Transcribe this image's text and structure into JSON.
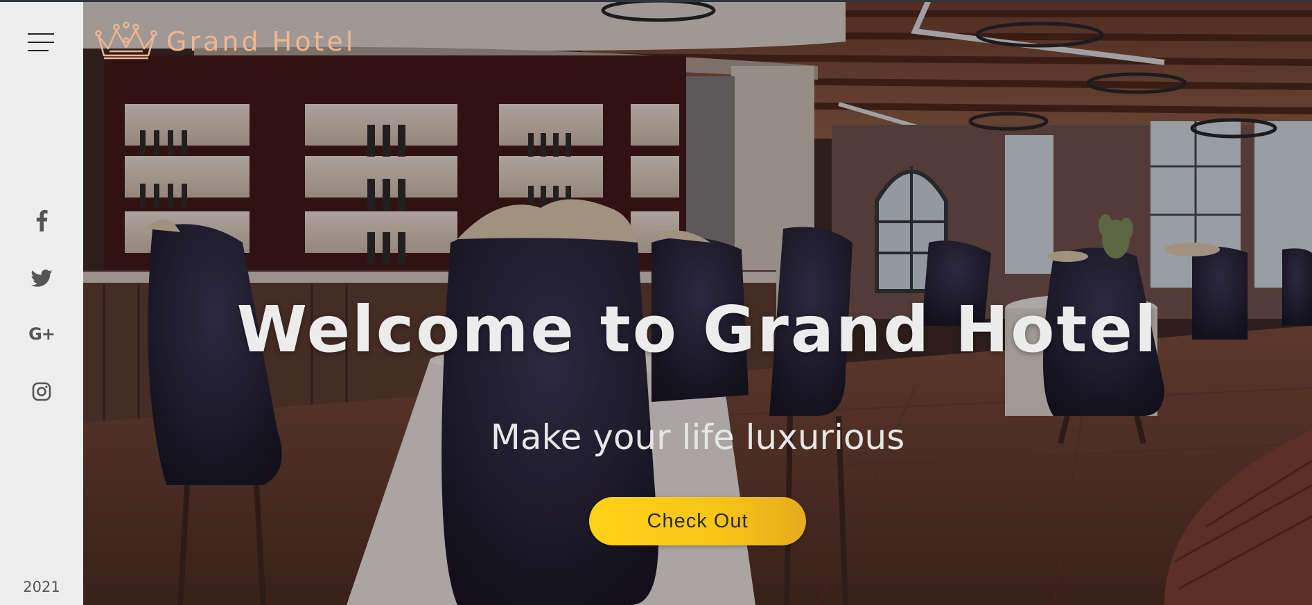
{
  "brand": {
    "name": "Grand Hotel",
    "logo_icon": "crown-icon",
    "color": "#f0b690"
  },
  "sidebar": {
    "menu_icon": "hamburger-menu-icon",
    "social": [
      {
        "name": "facebook-icon"
      },
      {
        "name": "twitter-icon"
      },
      {
        "name": "google-plus-icon",
        "label": "G+"
      },
      {
        "name": "instagram-icon"
      }
    ],
    "year": "2021"
  },
  "hero": {
    "title": "Welcome to Grand Hotel",
    "subtitle": "Make your life luxurious",
    "cta_label": "Check Out",
    "cta_color": "#ffd21a"
  }
}
